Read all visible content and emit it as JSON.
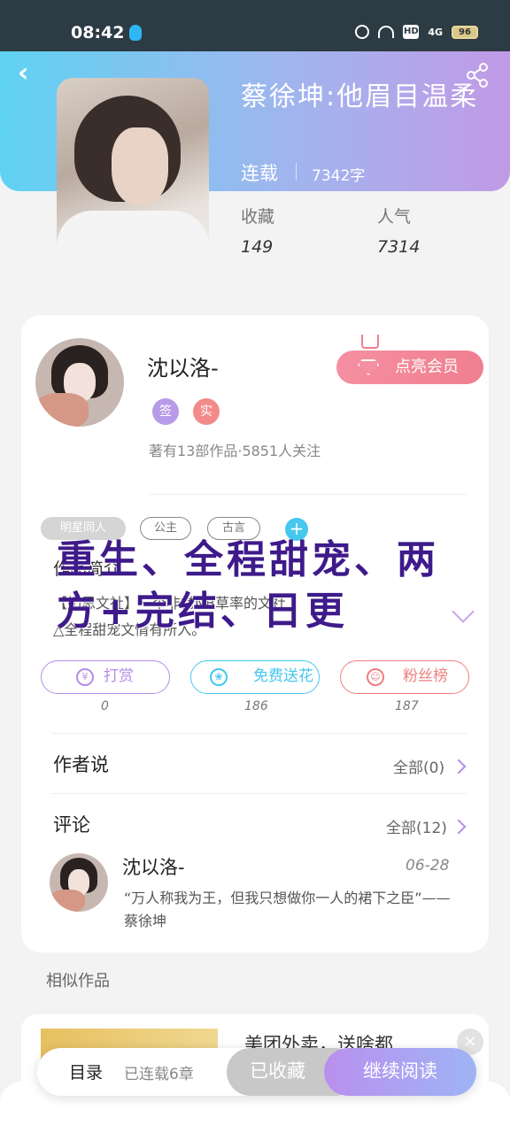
{
  "status_bar": {
    "time": "08:42",
    "signal": "4G",
    "battery": "96"
  },
  "book": {
    "title": "蔡徐坤:他眉目温柔",
    "status": "连载",
    "words": "7342字",
    "stats": [
      {
        "label": "收藏",
        "value": "149"
      },
      {
        "label": "人气",
        "value": "7314"
      }
    ]
  },
  "author": {
    "name": "沈以洛-",
    "vip_label": "点亮会员",
    "badges": [
      {
        "label": "签",
        "color": "#b89be8"
      },
      {
        "label": "实",
        "color": "#f28a8a"
      }
    ],
    "meta": "著有13部作品·5851人关注"
  },
  "tags": [
    "明星同人",
    "公主",
    "古言"
  ],
  "intro": {
    "label": "作品简介",
    "lines": [
      "【奶思文社】一个非常NB草率的文社",
      "△全程甜宠文情有所入。"
    ]
  },
  "overlay": "重生、全程甜宠、两方+完结、日更",
  "actions": [
    {
      "label": "打赏",
      "icon": "¥",
      "count": "0",
      "color": "#b58de8"
    },
    {
      "label": "免费送花",
      "icon": "❀",
      "count": "186",
      "color": "#45c7ee"
    },
    {
      "label": "粉丝榜",
      "icon": "☺",
      "count": "187",
      "color": "#f07f7f"
    }
  ],
  "author_says": {
    "title": "作者说",
    "link": "全部(0)"
  },
  "comments": {
    "title": "评论",
    "link": "全部(12)",
    "item": {
      "name": "沈以洛-",
      "date": "06-28",
      "text": "“万人称我为王，但我只想做你一人的裙下之臣”——蔡徐坤"
    }
  },
  "similar": {
    "label": "相似作品",
    "title": "美团外卖，送啥都"
  },
  "bottom": {
    "toc_label": "目录",
    "toc_count": "已连载6章",
    "collected": "已收藏",
    "continue": "继续阅读"
  }
}
